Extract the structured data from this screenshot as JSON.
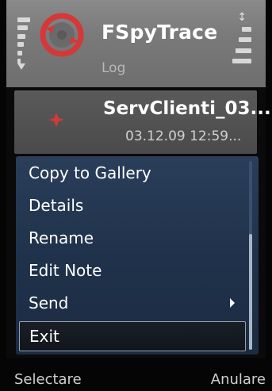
{
  "header": {
    "app_title": "FSpyTrace",
    "view_name": "Log",
    "app_icon": "fspytrace-app-icon",
    "signal_icon": "signal-strength-icon",
    "battery_icon": "battery-level-icon"
  },
  "file_item": {
    "name": "ServClienti_03...",
    "date": "03.12.09 12:59...",
    "icon": "red-marker-icon"
  },
  "options_menu": {
    "items": [
      {
        "label": "Copy to Gallery"
      },
      {
        "label": "Details"
      },
      {
        "label": "Rename"
      },
      {
        "label": "Edit Note"
      },
      {
        "label": "Send",
        "submenu": true
      },
      {
        "label": "Exit",
        "selected": true
      }
    ]
  },
  "softkeys": {
    "left": "Selectare",
    "right": "Anulare"
  },
  "colors": {
    "menu_bg": "#22344d",
    "header_bg": "#7a7a7a",
    "accent_red": "#d43838"
  }
}
